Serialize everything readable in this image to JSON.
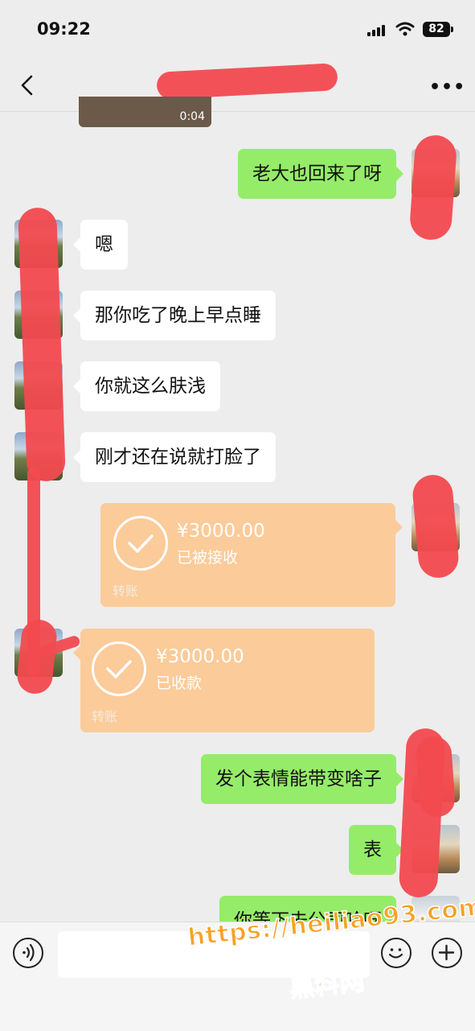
{
  "status_bar": {
    "time": "09:22",
    "battery": "82"
  },
  "header": {
    "title": ""
  },
  "video": {
    "duration": "0:04"
  },
  "messages": [
    {
      "side": "right",
      "text": "老大也回来了呀"
    },
    {
      "side": "left",
      "text": "嗯"
    },
    {
      "side": "left",
      "text": "那你吃了晚上早点睡"
    },
    {
      "side": "left",
      "text": "你就这么肤浅"
    },
    {
      "side": "left",
      "text": "刚才还在说就打脸了"
    },
    {
      "side": "right",
      "text": "发个表情能带变啥子"
    },
    {
      "side": "right",
      "text": "表"
    },
    {
      "side": "right",
      "text": "你等下去公司哈呀"
    }
  ],
  "transfers": [
    {
      "side": "right",
      "amount": "¥3000.00",
      "status": "已被接收",
      "label": "转账"
    },
    {
      "side": "left",
      "amount": "¥3000.00",
      "status": "已收款",
      "label": "转账"
    }
  ],
  "watermark": {
    "url": "https://heiliao93.com",
    "name": "黑料网"
  },
  "colors": {
    "background": "#ededed",
    "bubble_self": "#95ec69",
    "bubble_other": "#ffffff",
    "transfer": "#fbcb9a",
    "redaction": "#f24a4f"
  },
  "icons": [
    "back-icon",
    "more-icon",
    "signal-icon",
    "wifi-icon",
    "voice-icon",
    "emoji-icon",
    "plus-icon"
  ]
}
